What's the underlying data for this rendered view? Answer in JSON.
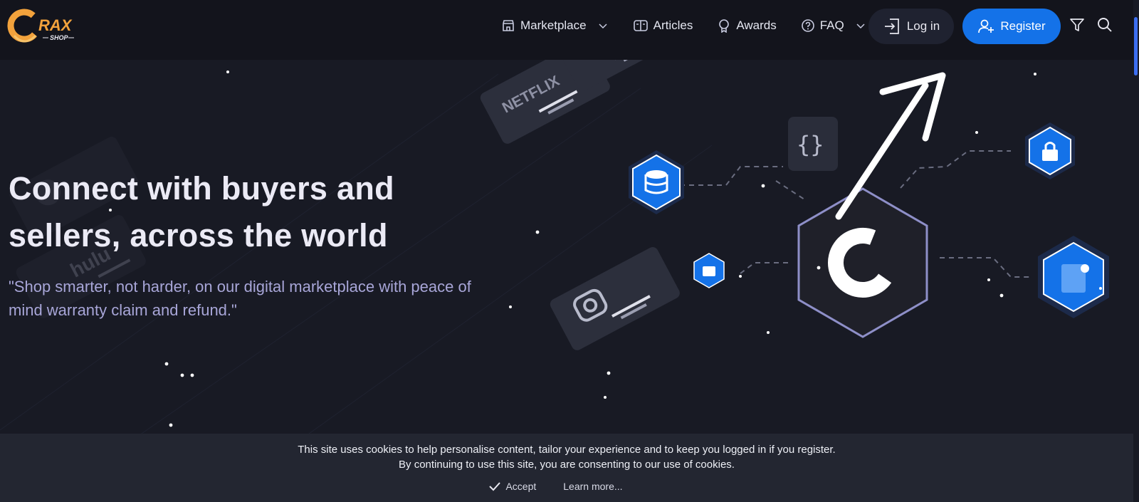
{
  "brand": {
    "logo_text": "RAX",
    "logo_sub": "SHOP",
    "accent": "#f2a23c"
  },
  "nav": {
    "items": [
      {
        "label": "Marketplace",
        "icon": "store-icon",
        "has_dropdown": true
      },
      {
        "label": "Articles",
        "icon": "book-icon",
        "has_dropdown": false
      },
      {
        "label": "Awards",
        "icon": "award-icon",
        "has_dropdown": false
      },
      {
        "label": "FAQ",
        "icon": "help-circle-icon",
        "has_dropdown": true
      }
    ],
    "login_label": "Log in",
    "register_label": "Register",
    "register_color": "#1472e8"
  },
  "hero": {
    "title": "Connect with buyers and sellers, across the world",
    "subtitle": "\"Shop smarter, not harder, on our digital marketplace with peace of mind warranty claim and refund.\"",
    "card_labels": [
      "NETFLIX",
      "hulu"
    ]
  },
  "cookie": {
    "line1": "This site uses cookies to help personalise content, tailor your experience and to keep you logged in if you register.",
    "line2": "By continuing to use this site, you are consenting to our use of cookies.",
    "accept_label": "Accept",
    "learn_label": "Learn more..."
  }
}
